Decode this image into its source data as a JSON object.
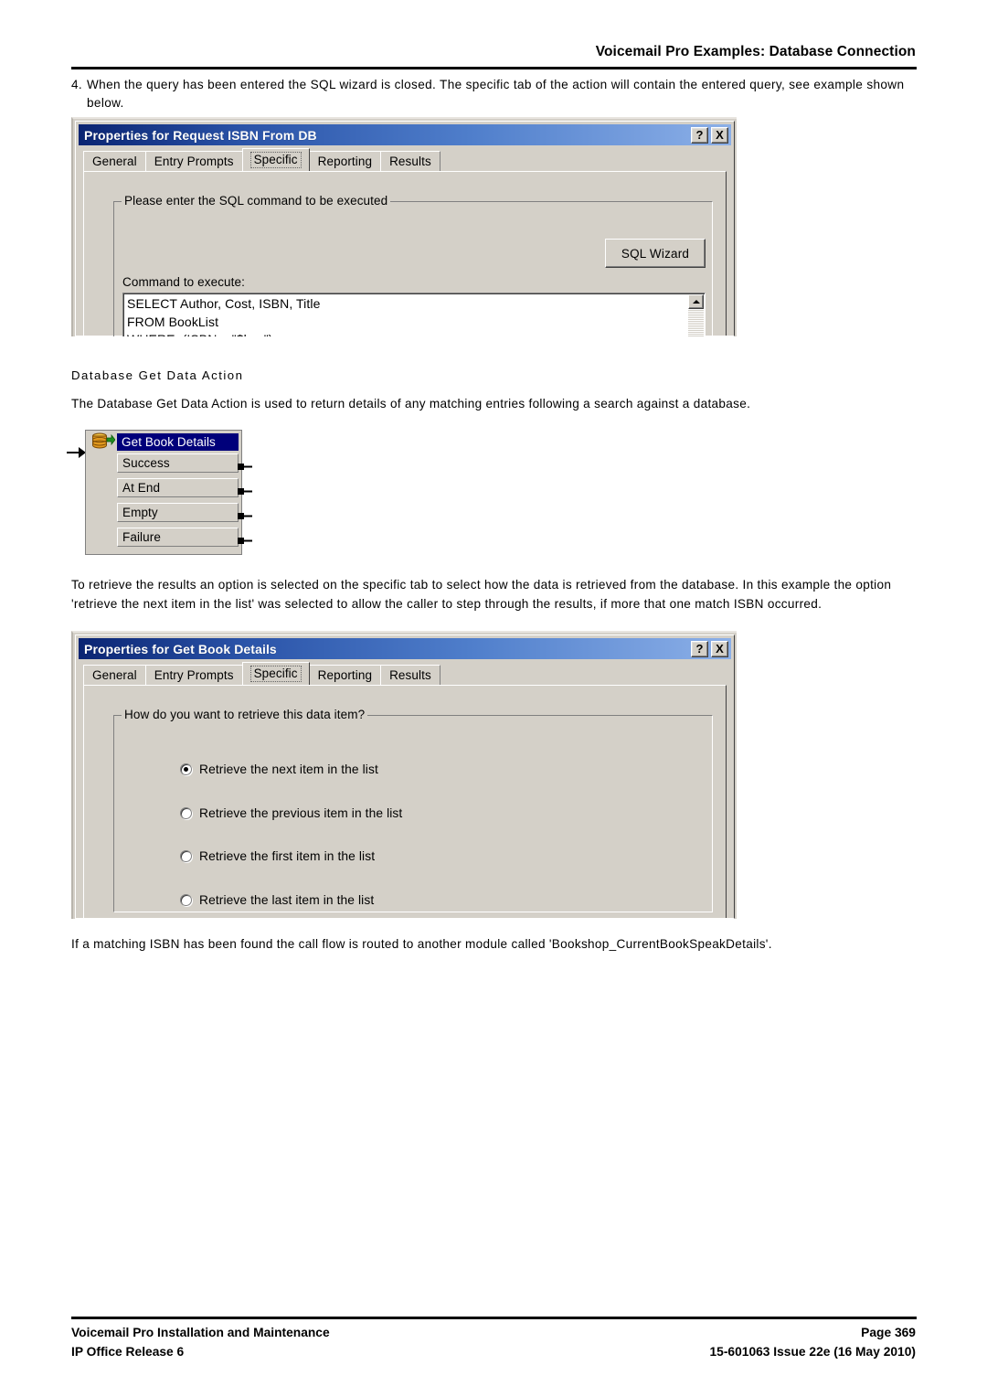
{
  "header": {
    "title": "Voicemail Pro Examples: Database Connection"
  },
  "body": {
    "step_number": "4.",
    "step_text": "When the query has been entered the SQL wizard is closed. The specific tab of the action will contain the entered query, see example shown below.",
    "subheading": "Database Get Data Action",
    "para_intro": "The Database Get Data Action is used to return details of any matching entries following a search against a database.",
    "para_retrieve": "To retrieve the results an option is selected on the specific tab to select how the data is retrieved from the database. In this example the option 'retrieve the next item in the list' was selected to allow the caller to step through the results, if more that one match ISBN occurred.",
    "para_routed": "If a matching ISBN has been found the call flow is routed to another module called 'Bookshop_CurrentBookSpeakDetails'."
  },
  "dialog1": {
    "title": "Properties for Request ISBN From DB",
    "help_button": "?",
    "close_button": "X",
    "tabs": [
      {
        "label": "General",
        "accel": "G",
        "selected": false
      },
      {
        "label": "Entry Prompts",
        "accel": "",
        "selected": false
      },
      {
        "label": "Specific",
        "accel": "",
        "selected": true
      },
      {
        "label": "Reporting",
        "accel": "g",
        "selected": false
      },
      {
        "label": "Results",
        "accel": "",
        "selected": false
      }
    ],
    "group_label": "Please enter the SQL command to be executed",
    "sql_wizard_button": "SQL Wizard",
    "command_label": "Command to execute:",
    "command_value": "SELECT Author, Cost, ISBN, Title\nFROM BookList\nWHERE  (ISBN = \"$key\") ;"
  },
  "flow": {
    "title": "Get Book Details",
    "icon": "database-icon",
    "connections": [
      "Success",
      "At End",
      "Empty",
      "Failure"
    ]
  },
  "dialog2": {
    "title": "Properties for Get Book Details",
    "help_button": "?",
    "close_button": "X",
    "tabs": [
      {
        "label": "General",
        "accel": "G",
        "selected": false
      },
      {
        "label": "Entry Prompts",
        "accel": "",
        "selected": false
      },
      {
        "label": "Specific",
        "accel": "",
        "selected": true
      },
      {
        "label": "Reporting",
        "accel": "g",
        "selected": false
      },
      {
        "label": "Results",
        "accel": "",
        "selected": false
      }
    ],
    "group_label": "How do you want to retrieve this data item?",
    "options": [
      {
        "label": "Retrieve the next item in the list",
        "checked": true
      },
      {
        "label": "Retrieve the previous item in the list",
        "checked": false
      },
      {
        "label": "Retrieve the first item in the list",
        "checked": false
      },
      {
        "label": "Retrieve the last item in the list",
        "checked": false
      }
    ]
  },
  "footer": {
    "left_line1": "Voicemail Pro Installation and Maintenance",
    "left_line2": "IP Office Release 6",
    "right_line1": "Page 369",
    "right_line2": "15-601063 Issue 22e (16 May 2010)"
  },
  "colors": {
    "titlebar_dark": "#0a2472",
    "titlebar_light": "#8cb0e8",
    "dialog_face": "#d4d0c8",
    "flow_title_bg": "#00007a",
    "db_icon_body": "#e0981e",
    "db_icon_arrow": "#1f8f1f"
  }
}
